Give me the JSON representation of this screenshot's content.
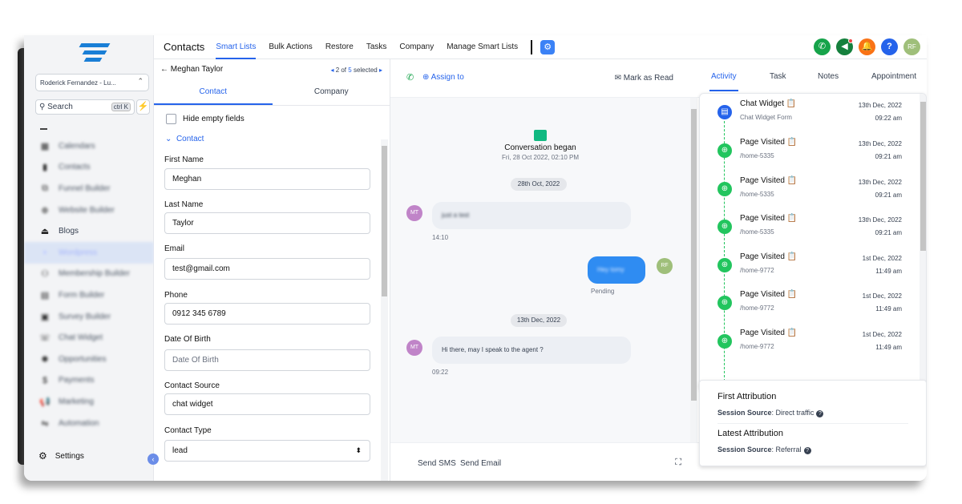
{
  "topbar": {
    "title": "Contacts",
    "tabs": [
      "Smart Lists",
      "Bulk Actions",
      "Restore",
      "Tasks",
      "Company",
      "Manage Smart Lists"
    ],
    "user_initials": "RF"
  },
  "sidebar": {
    "account": "Roderick Fernandez - Lu...",
    "search_placeholder": "Search",
    "search_shortcut": "ctrl K",
    "items": [
      {
        "label": "Calendars",
        "icon": "calendar-icon"
      },
      {
        "label": "Contacts",
        "icon": "contacts-icon"
      },
      {
        "label": "Funnel Builder",
        "icon": "funnel-icon"
      },
      {
        "label": "Website Builder",
        "icon": "globe-icon"
      },
      {
        "label": "Blogs",
        "icon": "blog-icon"
      },
      {
        "label": "Wordpress",
        "icon": "wordpress-icon"
      },
      {
        "label": "Membership Builder",
        "icon": "membership-icon"
      },
      {
        "label": "Form Builder",
        "icon": "form-icon"
      },
      {
        "label": "Survey Builder",
        "icon": "survey-icon"
      },
      {
        "label": "Chat Widget",
        "icon": "chat-icon"
      },
      {
        "label": "Opportunities",
        "icon": "opportunities-icon"
      },
      {
        "label": "Payments",
        "icon": "payments-icon"
      },
      {
        "label": "Marketing",
        "icon": "megaphone-icon"
      },
      {
        "label": "Automation",
        "icon": "automation-icon"
      }
    ],
    "settings": "Settings"
  },
  "contact": {
    "name": "Meghan Taylor",
    "pager_prefix": "2 of",
    "pager_count": "5",
    "pager_suffix": "selected",
    "tabs": [
      "Contact",
      "Company"
    ],
    "hide_empty": "Hide empty fields",
    "section": "Contact",
    "fields": [
      {
        "label": "First Name",
        "value": "Meghan",
        "placeholder": false
      },
      {
        "label": "Last Name",
        "value": "Taylor",
        "placeholder": false
      },
      {
        "label": "Email",
        "value": "test@gmail.com",
        "placeholder": false
      },
      {
        "label": "Phone",
        "value": "0912 345 6789",
        "placeholder": false
      },
      {
        "label": "Date Of Birth",
        "value": "Date Of Birth",
        "placeholder": true
      },
      {
        "label": "Contact Source",
        "value": "chat widget",
        "placeholder": false
      },
      {
        "label": "Contact Type",
        "value": "lead",
        "placeholder": false
      }
    ]
  },
  "conversation": {
    "assign": "Assign to",
    "mark_read": "Mark as Read",
    "began_title": "Conversation began",
    "began_date": "Fri, 28 Oct 2022, 02:10 PM",
    "date1": "28th Oct, 2022",
    "msg1": "just a test",
    "msg1_time": "14:10",
    "msg1_initials": "MT",
    "msg2": "Hey tomy",
    "msg2_status": "Pending",
    "msg2_initials": "RF",
    "date2": "13th Dec, 2022",
    "msg3": "Hi there, may I speak to the agent ?",
    "msg3_time": "09:22",
    "msg3_initials": "MT",
    "send_sms": "Send SMS",
    "send_email": "Send Email"
  },
  "activity": {
    "tabs": [
      "Activity",
      "Task",
      "Notes",
      "Appointment"
    ],
    "items": [
      {
        "title": "Chat Widget",
        "sub": "Chat Widget Form",
        "date": "13th Dec, 2022",
        "time": "09:22 am",
        "type": "form"
      },
      {
        "title": "Page Visited",
        "sub": "/home-5335",
        "date": "13th Dec, 2022",
        "time": "09:21 am",
        "type": "page"
      },
      {
        "title": "Page Visited",
        "sub": "/home-5335",
        "date": "13th Dec, 2022",
        "time": "09:21 am",
        "type": "page"
      },
      {
        "title": "Page Visited",
        "sub": "/home-5335",
        "date": "13th Dec, 2022",
        "time": "09:21 am",
        "type": "page"
      },
      {
        "title": "Page Visited",
        "sub": "/home-9772",
        "date": "1st Dec, 2022",
        "time": "11:49 am",
        "type": "page"
      },
      {
        "title": "Page Visited",
        "sub": "/home-9772",
        "date": "1st Dec, 2022",
        "time": "11:49 am",
        "type": "page"
      },
      {
        "title": "Page Visited",
        "sub": "/home-9772",
        "date": "1st Dec, 2022",
        "time": "11:49 am",
        "type": "page"
      }
    ],
    "first_attr_title": "First Attribution",
    "first_attr_label": "Session Source",
    "first_attr_value": ": Direct traffic",
    "latest_attr_title": "Latest Attribution",
    "latest_attr_label": "Session Source",
    "latest_attr_value": ": Referral"
  },
  "colors": {
    "accent": "#2563eb",
    "green": "#22c55e",
    "sidebar_active": "#dbe4f5"
  }
}
